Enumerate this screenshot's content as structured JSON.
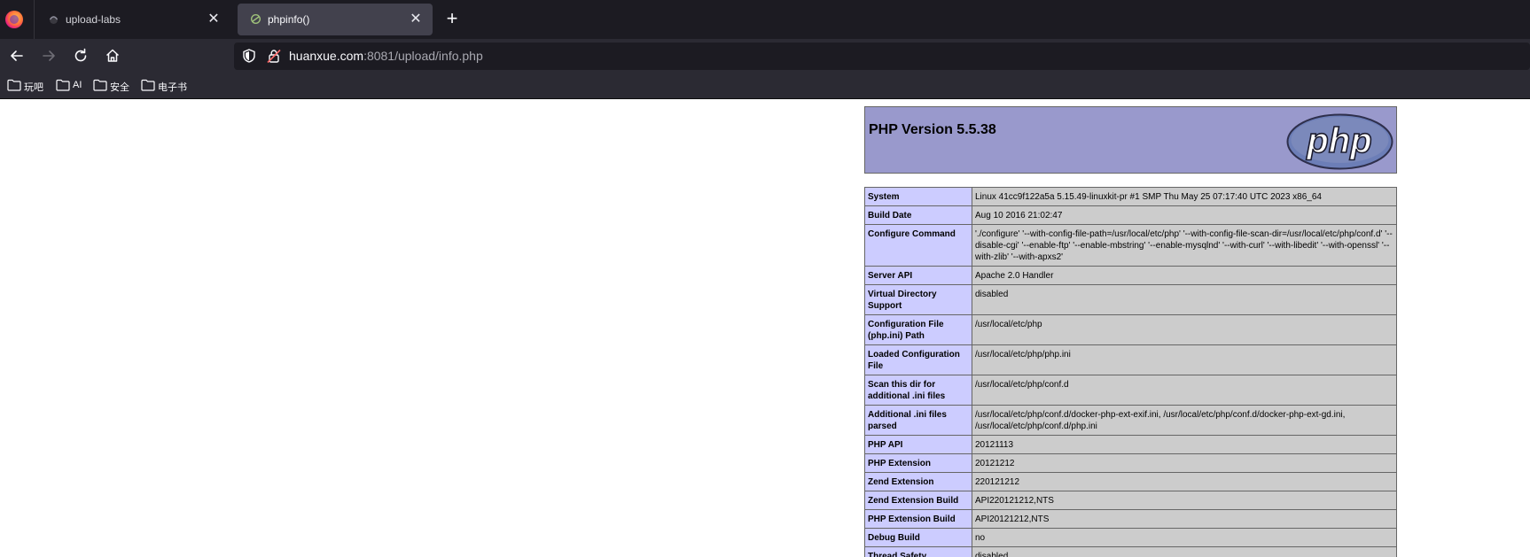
{
  "browser": {
    "tabs": [
      {
        "title": "upload-labs",
        "active": false
      },
      {
        "title": "phpinfo()",
        "active": true
      }
    ],
    "url_host": "huanxue.com",
    "url_rest": ":8081/upload/info.php",
    "bookmarks": [
      "玩吧",
      "AI",
      "安全",
      "电子书"
    ]
  },
  "page": {
    "heading": "PHP Version 5.5.38",
    "logo_text": "php",
    "rows": [
      {
        "key": "System",
        "value": "Linux 41cc9f122a5a 5.15.49-linuxkit-pr #1 SMP Thu May 25 07:17:40 UTC 2023 x86_64"
      },
      {
        "key": "Build Date",
        "value": "Aug 10 2016 21:02:47"
      },
      {
        "key": "Configure Command",
        "value": "'./configure' '--with-config-file-path=/usr/local/etc/php' '--with-config-file-scan-dir=/usr/local/etc/php/conf.d' '--disable-cgi' '--enable-ftp' '--enable-mbstring' '--enable-mysqlnd' '--with-curl' '--with-libedit' '--with-openssl' '--with-zlib' '--with-apxs2'"
      },
      {
        "key": "Server API",
        "value": "Apache 2.0 Handler"
      },
      {
        "key": "Virtual Directory Support",
        "value": "disabled"
      },
      {
        "key": "Configuration File (php.ini) Path",
        "value": "/usr/local/etc/php"
      },
      {
        "key": "Loaded Configuration File",
        "value": "/usr/local/etc/php/php.ini"
      },
      {
        "key": "Scan this dir for additional .ini files",
        "value": "/usr/local/etc/php/conf.d"
      },
      {
        "key": "Additional .ini files parsed",
        "value": "/usr/local/etc/php/conf.d/docker-php-ext-exif.ini, /usr/local/etc/php/conf.d/docker-php-ext-gd.ini, /usr/local/etc/php/conf.d/php.ini"
      },
      {
        "key": "PHP API",
        "value": "20121113"
      },
      {
        "key": "PHP Extension",
        "value": "20121212"
      },
      {
        "key": "Zend Extension",
        "value": "220121212"
      },
      {
        "key": "Zend Extension Build",
        "value": "API220121212,NTS"
      },
      {
        "key": "PHP Extension Build",
        "value": "API20121212,NTS"
      },
      {
        "key": "Debug Build",
        "value": "no"
      },
      {
        "key": "Thread Safety",
        "value": "disabled"
      }
    ]
  },
  "colors": {
    "header_bg": "#9999cc",
    "key_bg": "#ccccff",
    "value_bg": "#cccccc",
    "chrome_bg": "#2b2a33",
    "tabbar_bg": "#1c1b22"
  },
  "icons": [
    "firefox-logo-icon",
    "close-icon",
    "plus-icon",
    "back-arrow-icon",
    "forward-arrow-icon",
    "reload-icon",
    "home-icon",
    "shield-icon",
    "lock-icon",
    "folder-icon"
  ]
}
